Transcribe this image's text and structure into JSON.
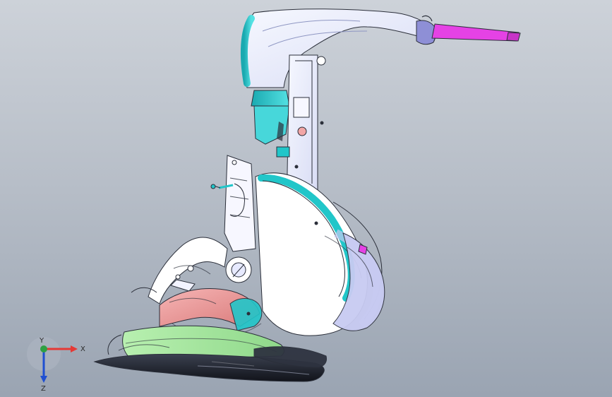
{
  "viewport": {
    "background_top": "#cdd2d9",
    "background_bottom": "#9aa4b2"
  },
  "triad": {
    "x_label": "X",
    "y_label": "Y",
    "z_label": "Z",
    "x_color": "#e53935",
    "y_color": "#2ea043",
    "z_color": "#1f4fd1"
  },
  "colors": {
    "cyan": "#21c6c9",
    "magenta": "#e542e5",
    "outline": "#2b2f3a",
    "white": "#f3f6ff",
    "lavender": "#c8cbf2",
    "pink": "#f2a6a6",
    "green": "#a8e6a1"
  }
}
